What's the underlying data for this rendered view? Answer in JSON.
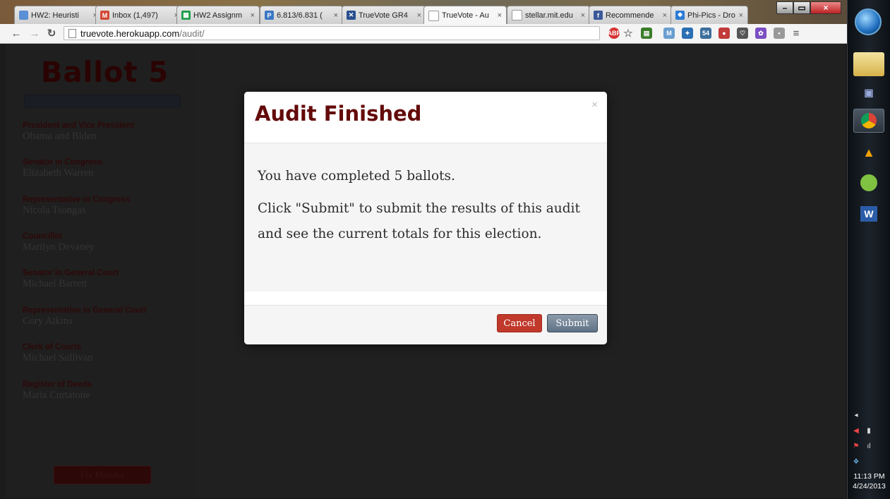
{
  "browser": {
    "tabs": [
      {
        "label": "HW2: Heuristi",
        "icon": "document-icon",
        "color": "#5b8fd6"
      },
      {
        "label": "Inbox (1,497)",
        "icon": "gmail-icon",
        "color": "#d14836"
      },
      {
        "label": "HW2 Assignm",
        "icon": "sheets-icon",
        "color": "#1e9e4a"
      },
      {
        "label": "6.813/6.831 (",
        "icon": "piazza-icon",
        "color": "#3b78c4"
      },
      {
        "label": "TrueVote GR4",
        "icon": "truevote-icon",
        "color": "#2a4f8f"
      },
      {
        "label": "TrueVote - Au",
        "icon": "page-icon",
        "color": "#888888"
      },
      {
        "label": "stellar.mit.edu",
        "icon": "page-icon",
        "color": "#888888"
      },
      {
        "label": "Recommende",
        "icon": "facebook-icon",
        "color": "#3b5998"
      },
      {
        "label": "Phi-Pics - Dro",
        "icon": "dropbox-icon",
        "color": "#2c7bd6"
      }
    ],
    "url_host": "truevote.herokuapp.com",
    "url_path": "/audit/"
  },
  "page": {
    "ballot_title": "Ballot 5",
    "races": [
      {
        "office": "President and Vice President",
        "candidate": "Obama and Biden"
      },
      {
        "office": "Senator in Congress",
        "candidate": "Elizabeth Warren"
      },
      {
        "office": "Representative in Congress",
        "candidate": "Nicola Tsongas"
      },
      {
        "office": "Councillor",
        "candidate": "Marilyn Devaney"
      },
      {
        "office": "Senator in General Court",
        "candidate": "Michael Barrett"
      },
      {
        "office": "Representative in General Court",
        "candidate": "Cory Atkins"
      },
      {
        "office": "Clerk of Courts",
        "candidate": "Michael Sullivan"
      },
      {
        "office": "Register of Deeds",
        "candidate": "Maria Curtatone"
      }
    ],
    "fix_button": "Fix Mistake"
  },
  "modal": {
    "title": "Audit Finished",
    "close": "×",
    "line1": "You have completed 5 ballots.",
    "line2": "Click \"Submit\" to submit the results of this audit and see the current totals for this election.",
    "cancel_label": "Cancel",
    "submit_label": "Submit"
  },
  "taskbar": {
    "time": "11:13 PM",
    "date": "4/24/2013"
  },
  "colors": {
    "accent": "#640a0a",
    "cancel": "#c0392b",
    "submit": "#6b7e90"
  }
}
